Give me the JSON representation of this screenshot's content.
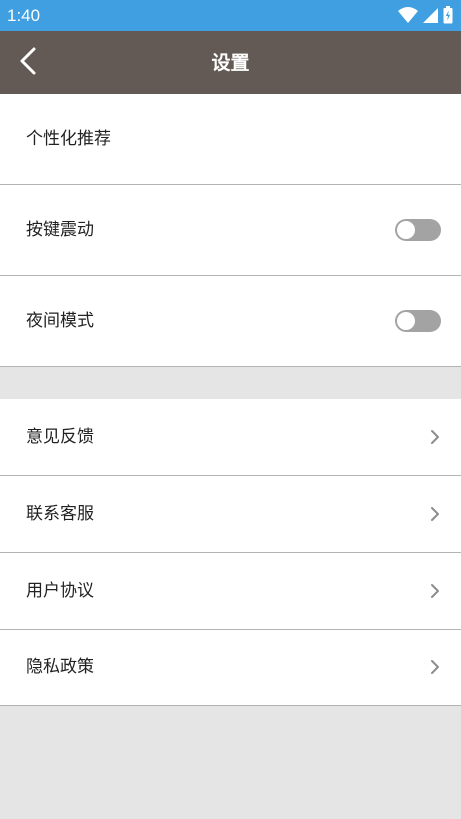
{
  "status_bar": {
    "time": "1:40",
    "icons": [
      "wifi-icon",
      "signal-icon",
      "battery-icon"
    ]
  },
  "header": {
    "title": "设置",
    "back_icon": "chevron-left-icon"
  },
  "groups": [
    {
      "items": [
        {
          "label": "个性化推荐"
        },
        {
          "label": "按键震动",
          "toggle": false
        },
        {
          "label": "夜间模式",
          "toggle": false
        }
      ]
    },
    {
      "items": [
        {
          "label": "意见反馈",
          "icon": "chevron-right-icon"
        },
        {
          "label": "联系客服",
          "icon": "chevron-right-icon"
        },
        {
          "label": "用户协议",
          "icon": "chevron-right-icon"
        },
        {
          "label": "隐私政策",
          "icon": "chevron-right-icon"
        }
      ]
    }
  ],
  "colors": {
    "status_bar": "#3f9fe0",
    "app_bar": "#645a55",
    "background": "#e5e5e5",
    "toggle_off": "#a3a3a3",
    "divider": "#b3b3b3"
  }
}
